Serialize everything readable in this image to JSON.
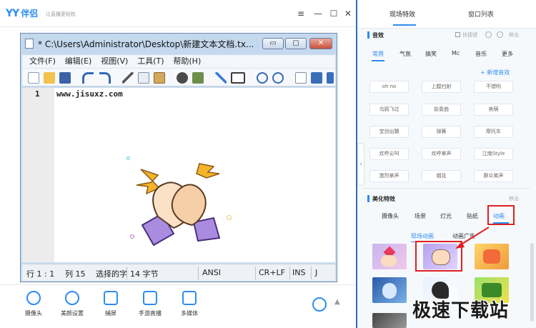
{
  "yy": {
    "logo": "YY",
    "logo_cn": "伴侣",
    "slogan": "让直播更轻松",
    "buttons": {
      "menu": "≡",
      "minimize": "—",
      "maximize": "☐",
      "close": "✕"
    }
  },
  "notepad": {
    "title": "* C:\\Users\\Administrator\\Desktop\\新建文本文档.tx...",
    "buttons": {
      "minimize": "▭",
      "maximize": "▢",
      "close": "✕"
    },
    "menu": [
      "文件(F)",
      "编辑(E)",
      "视图(V)",
      "工具(T)",
      "帮助(H)"
    ],
    "line_number": "1",
    "code": "www.jisuxz.com",
    "status": {
      "position": "行 1 : 1",
      "column": "列 15",
      "selection": "选择的字",
      "bytes": "14 字节",
      "encoding": "ANSI",
      "line_ending": "CR+LF",
      "mode": "INS",
      "extra": "J"
    }
  },
  "bottom_bar": {
    "items": [
      "摄像头",
      "美颜设置",
      "捕屏",
      "手游直播",
      "多媒体"
    ]
  },
  "right_panel": {
    "tabs": {
      "live_effects": "现场特效",
      "window_list": "窗口列表"
    },
    "handle": "‹",
    "sound": {
      "title": "音效",
      "shortcut": "快捷键",
      "remove": "移出",
      "categories": [
        "常用",
        "气氛",
        "搞笑",
        "Mc",
        "音乐",
        "更多"
      ],
      "add": "+ 新增音效",
      "chips": [
        [
          "oh no",
          "上膛扫射",
          "不错哟"
        ],
        [
          "乌鸦飞过",
          "前奏曲",
          "卖萌"
        ],
        [
          "宝剑出鞘",
          "弹簧",
          "摩托车"
        ],
        [
          "欢呼尖叫",
          "欢呼掌声",
          "江南Style"
        ],
        [
          "激烈掌声",
          "烟花",
          "群众笑声"
        ]
      ]
    },
    "beauty": {
      "title": "美化特效",
      "remove": "移出",
      "tabs": [
        "摄像头",
        "场景",
        "灯光",
        "贴纸",
        "动画"
      ],
      "subtabs": [
        "现场动画",
        "动画广告"
      ]
    }
  },
  "watermark": "极速下载站",
  "colors": {
    "accent": "#2d8cf0",
    "highlight": "#e02020",
    "bg": "#2a6fb8"
  }
}
